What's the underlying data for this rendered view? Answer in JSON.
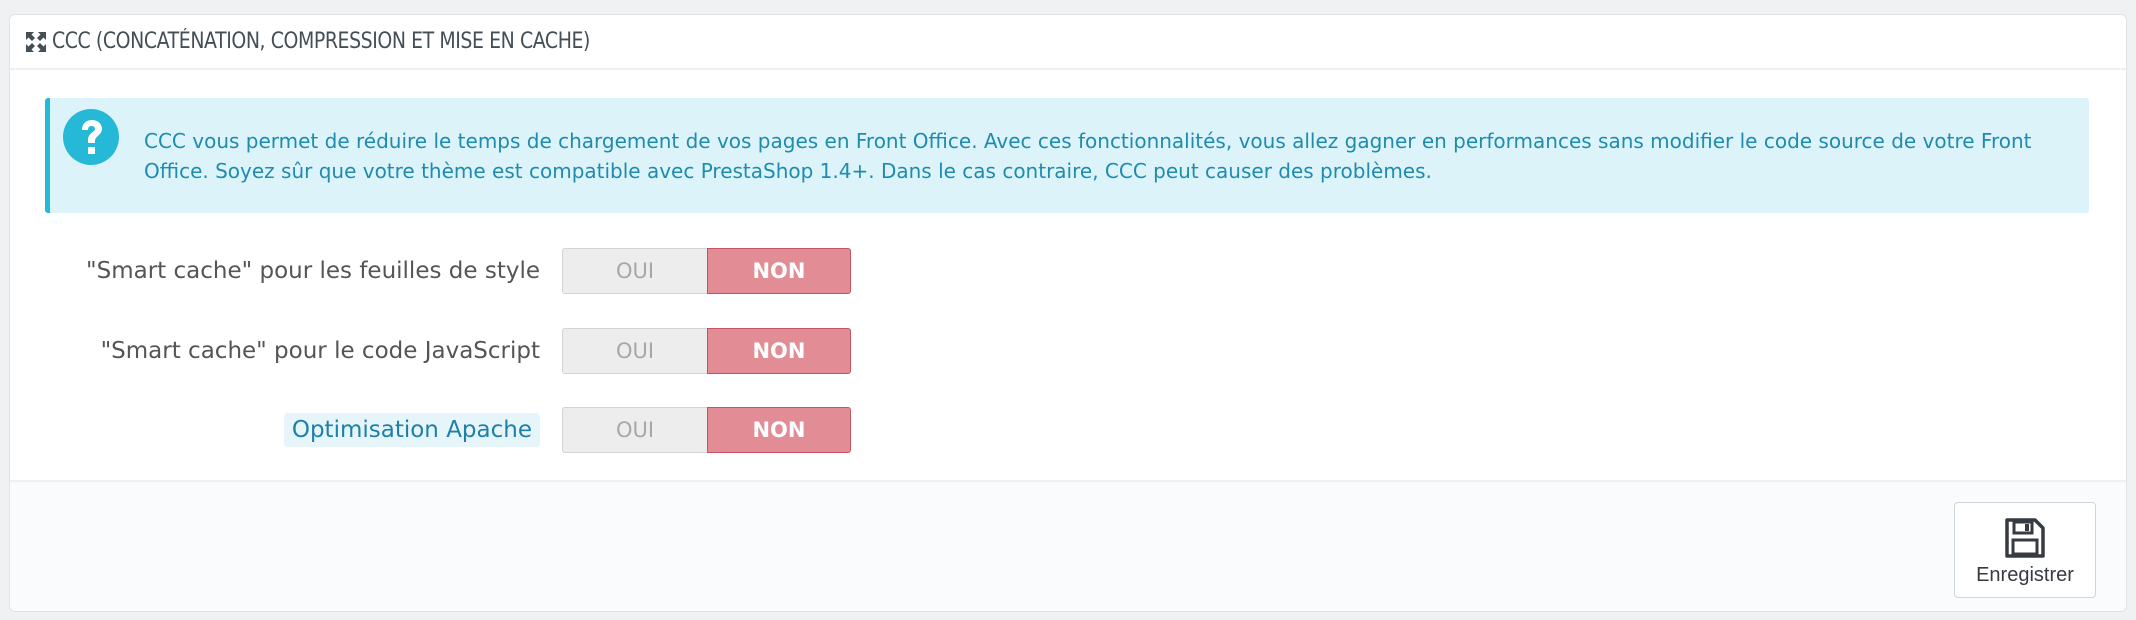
{
  "panel": {
    "title": "CCC (CONCATÉNATION, COMPRESSION ET MISE EN CACHE)",
    "icon": "expand-arrows-icon"
  },
  "alert": {
    "icon": "question-circle-icon",
    "text": "CCC vous permet de réduire le temps de chargement de vos pages en Front Office. Avec ces fonctionnalités, vous allez gagner en performances sans modifier le code source de votre Front Office. Soyez sûr que votre thème est compatible avec PrestaShop 1.4+. Dans le cas contraire, CCC peut causer des problèmes.",
    "color": "#1f8bae",
    "background": "#dcf4f9"
  },
  "settings": [
    {
      "label": "\"Smart cache\" pour les feuilles de style",
      "yes": "OUI",
      "no": "NON",
      "value": "NON"
    },
    {
      "label": "\"Smart cache\" pour le code JavaScript",
      "yes": "OUI",
      "no": "NON",
      "value": "NON"
    },
    {
      "label": "Optimisation Apache",
      "yes": "OUI",
      "no": "NON",
      "value": "NON"
    }
  ],
  "footer": {
    "save_label": "Enregistrer",
    "save_icon": "floppy-disk-icon"
  },
  "colors": {
    "selected_no": "#e28d95",
    "unselected": "#ededed",
    "accent": "#25b9d7"
  }
}
